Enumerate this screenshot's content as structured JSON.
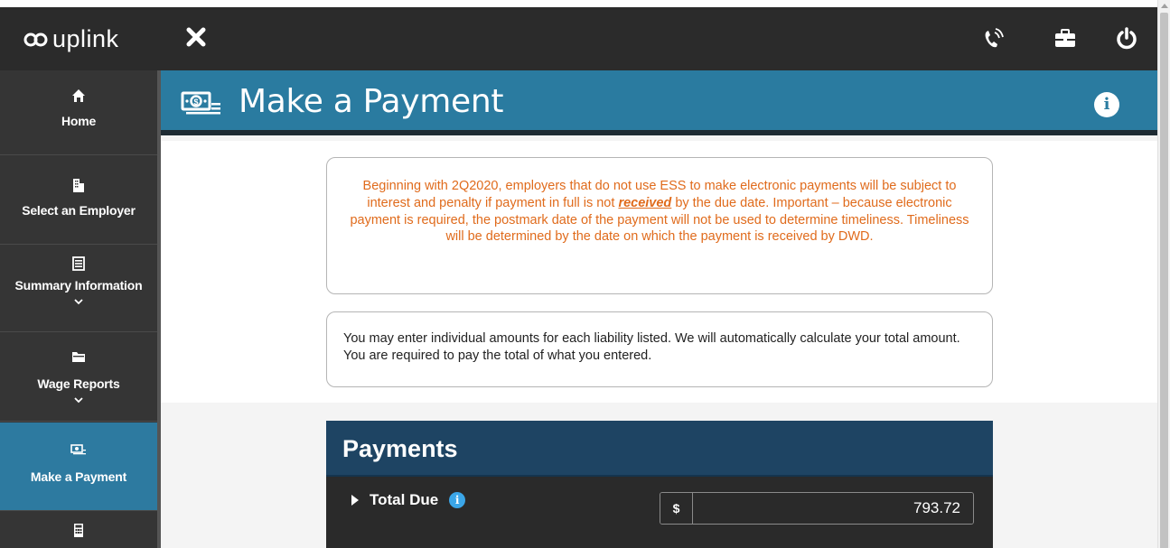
{
  "app": {
    "logo_text": "uplink"
  },
  "sidebar": {
    "items": [
      {
        "label": "Home",
        "icon": "home-icon"
      },
      {
        "label": "Select an Employer",
        "icon": "building-icon"
      },
      {
        "label": "Summary Information",
        "icon": "list-icon",
        "expandable": true
      },
      {
        "label": "Wage Reports",
        "icon": "folder-icon",
        "expandable": true
      },
      {
        "label": "Make a Payment",
        "icon": "money-icon",
        "active": true
      },
      {
        "label": "",
        "icon": "calculator-icon"
      }
    ]
  },
  "header": {
    "title": "Make a Payment"
  },
  "notice": {
    "text_before": "Beginning with 2Q2020, employers that do not use ESS to make electronic payments will be subject to interest and penalty if payment in full is not ",
    "emphasis": "received",
    "text_after": " by the due date. Important – because electronic payment is required, the postmark date of the payment will not be used to determine timeliness. Timeliness will be determined by the date on which the payment is received by DWD."
  },
  "info": {
    "text": "You may enter individual amounts for each liability listed. We will automatically calculate your total amount. You are required to pay the total of what you entered."
  },
  "payments": {
    "title": "Payments",
    "total_label": "Total Due",
    "currency_symbol": "$",
    "total_amount": "793.72"
  },
  "colors": {
    "topbar": "#2b2b2b",
    "sidebar": "#353535",
    "accent": "#2a7ba0",
    "notice_text": "#e06b1c",
    "payments_header": "#1e4463"
  }
}
